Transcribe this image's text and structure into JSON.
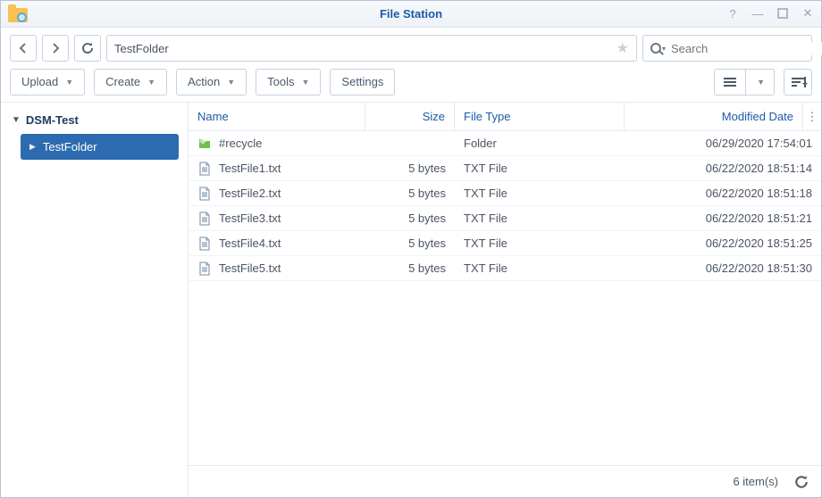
{
  "title": "File Station",
  "path": "TestFolder",
  "search_placeholder": "Search",
  "toolbar": {
    "upload": "Upload",
    "create": "Create",
    "action": "Action",
    "tools": "Tools",
    "settings": "Settings"
  },
  "tree": {
    "root": "DSM-Test",
    "child": "TestFolder"
  },
  "columns": {
    "name": "Name",
    "size": "Size",
    "type": "File Type",
    "date": "Modified Date"
  },
  "rows": [
    {
      "icon": "folder",
      "name": "#recycle",
      "size": "",
      "type": "Folder",
      "date": "06/29/2020 17:54:01"
    },
    {
      "icon": "txt",
      "name": "TestFile1.txt",
      "size": "5 bytes",
      "type": "TXT File",
      "date": "06/22/2020 18:51:14"
    },
    {
      "icon": "txt",
      "name": "TestFile2.txt",
      "size": "5 bytes",
      "type": "TXT File",
      "date": "06/22/2020 18:51:18"
    },
    {
      "icon": "txt",
      "name": "TestFile3.txt",
      "size": "5 bytes",
      "type": "TXT File",
      "date": "06/22/2020 18:51:21"
    },
    {
      "icon": "txt",
      "name": "TestFile4.txt",
      "size": "5 bytes",
      "type": "TXT File",
      "date": "06/22/2020 18:51:25"
    },
    {
      "icon": "txt",
      "name": "TestFile5.txt",
      "size": "5 bytes",
      "type": "TXT File",
      "date": "06/22/2020 18:51:30"
    }
  ],
  "status": {
    "count": "6 item(s)"
  }
}
